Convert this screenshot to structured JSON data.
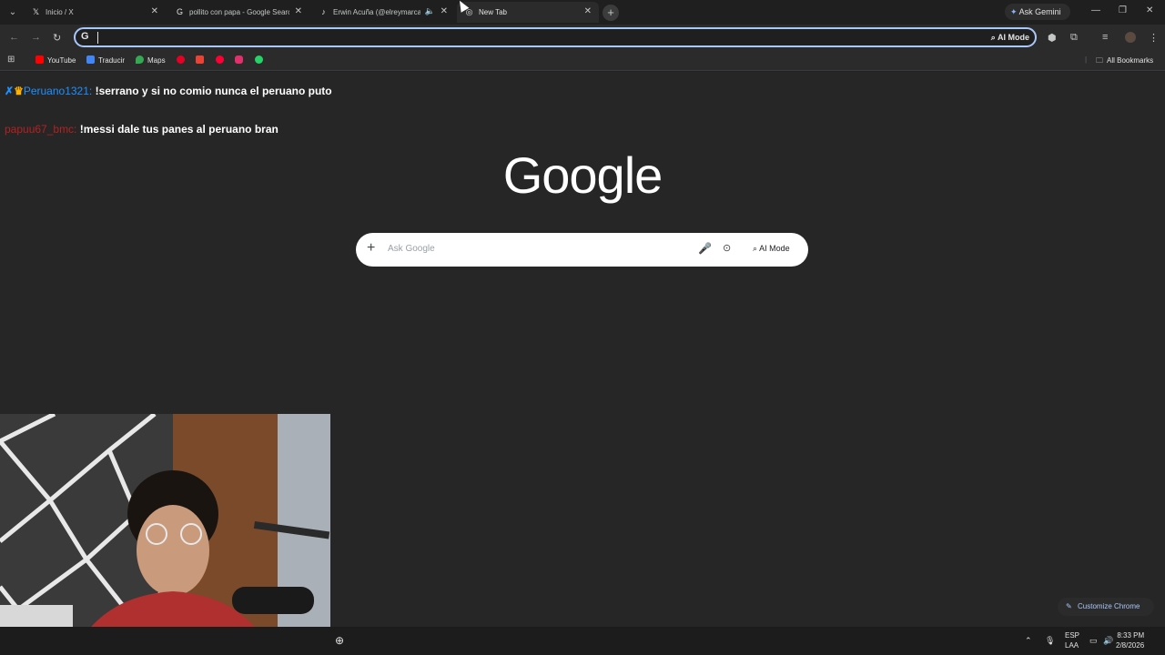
{
  "tabs": [
    {
      "title": "Inicio / X",
      "icon": "x-icon"
    },
    {
      "title": "pollito con papa - Google Search",
      "icon": "google-icon"
    },
    {
      "title": "Erwin Acuña (@elreymarcas)",
      "icon": "tiktok-icon"
    },
    {
      "title": "New Tab",
      "icon": "chrome-icon"
    }
  ],
  "gemini_label": "Ask Gemini",
  "omnibox": {
    "ai_mode_label": "AI Mode"
  },
  "bookmarks": {
    "items": [
      {
        "label": "YouTube",
        "color": "#ff0000"
      },
      {
        "label": "Traducir",
        "color": "#4285f4"
      },
      {
        "label": "Maps",
        "color": "#34a853"
      },
      {
        "label": "",
        "color": "#e60023"
      },
      {
        "label": "",
        "color": "#ea4335"
      },
      {
        "label": "",
        "color": "#ff0033"
      },
      {
        "label": "",
        "color": "#e1306c"
      },
      {
        "label": "",
        "color": "#25d366"
      }
    ],
    "all_label": "All Bookmarks"
  },
  "chat": [
    {
      "user": "Peruano1321:",
      "message": "!serrano y si no comio nunca el peruano puto"
    },
    {
      "user": "papuu67_bmc:",
      "message": "!messi dale tus panes al peruano bran"
    }
  ],
  "google": {
    "logo": "Google",
    "placeholder": "Ask Google",
    "ai_mode_label": "AI Mode"
  },
  "customize_label": "Customize Chrome",
  "taskbar": {
    "lang_line1": "ESP",
    "lang_line2": "LAA",
    "time": "8:33 PM",
    "date": "2/8/2026"
  }
}
